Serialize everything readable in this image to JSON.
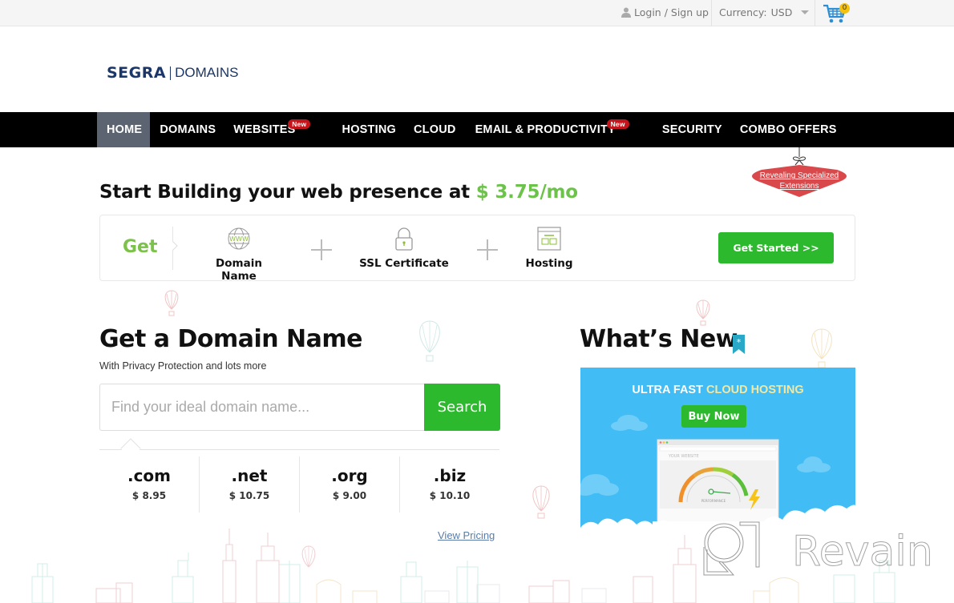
{
  "topbar": {
    "login_label": "Login / Sign up",
    "currency_label": "Currency:",
    "currency_value": "USD",
    "cart_count": "0"
  },
  "logo": {
    "brand": "SEGRA",
    "product": "DOMAINS"
  },
  "nav": {
    "items": [
      {
        "label": "HOME",
        "active": true
      },
      {
        "label": "DOMAINS"
      },
      {
        "label": "WEBSITES",
        "badge": "New"
      },
      {
        "label": "HOSTING"
      },
      {
        "label": "CLOUD"
      },
      {
        "label": "EMAIL & PRODUCTIVITY",
        "badge": "New"
      },
      {
        "label": "SECURITY"
      },
      {
        "label": "COMBO OFFERS"
      }
    ]
  },
  "ornament": {
    "line1": "Revealing Specialized",
    "line2": "Extensions"
  },
  "hero": {
    "headline": "Start Building your web presence at ",
    "price": "$ 3.75/mo",
    "get_label": "Get",
    "items": [
      {
        "label": "Domain Name",
        "icon": "www-globe-icon"
      },
      {
        "label": "SSL Certificate",
        "icon": "padlock-icon"
      },
      {
        "label": "Hosting",
        "icon": "hosting-window-icon"
      }
    ],
    "cta_label": "Get Started >>"
  },
  "domain": {
    "title": "Get a Domain Name",
    "subtitle": "With Privacy Protection and lots more",
    "search_placeholder": "Find your ideal domain name...",
    "search_value": "",
    "search_button": "Search",
    "tlds": [
      {
        "ext": ".com",
        "price": "$ 8.95"
      },
      {
        "ext": ".net",
        "price": "$ 10.75"
      },
      {
        "ext": ".org",
        "price": "$ 9.00"
      },
      {
        "ext": ".biz",
        "price": "$ 10.10"
      }
    ],
    "view_pricing": "View Pricing"
  },
  "whats_new": {
    "title": "What’s New",
    "promo_title_a": "ULTRA FAST ",
    "promo_title_b": "CLOUD HOSTING",
    "buy_label": "Buy Now",
    "mock_site_label": "YOUR WEBSITE",
    "gauge_label": "PERFORMANCE"
  },
  "watermark": {
    "text": "Revain"
  },
  "colors": {
    "accent_green": "#2db92d",
    "price_green": "#6cc24a",
    "nav_bg": "#000000",
    "nav_active": "#5b6470",
    "badge_red": "#c4151c",
    "brand_navy": "#1b3668",
    "promo_blue": "#41bcf5"
  }
}
